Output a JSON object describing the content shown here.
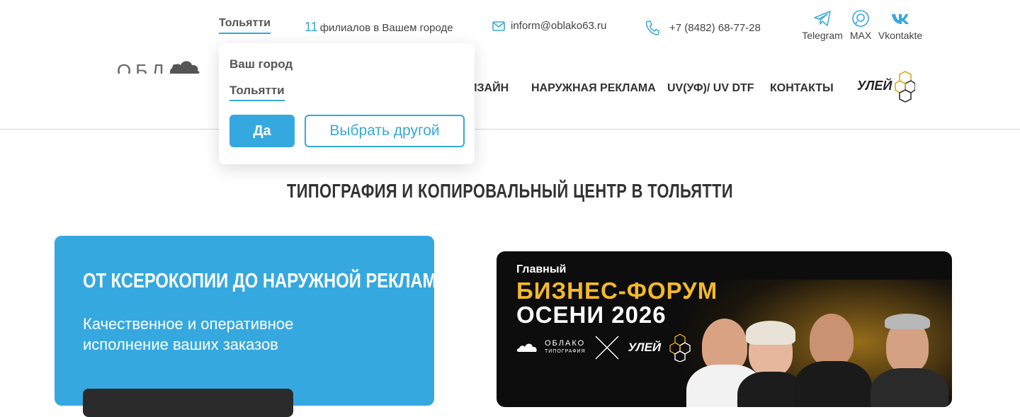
{
  "header": {
    "city": "Тольятти",
    "branches_count": "11",
    "branches_text": "филиалов в Вашем городе",
    "email": "inform@oblako63.ru",
    "phone": "+7 (8482) 68-77-28",
    "logo_text": "ОБЛА",
    "social": [
      {
        "label": "Telegram",
        "icon": "telegram-icon"
      },
      {
        "label": "MAX",
        "icon": "max-icon"
      },
      {
        "label": "Vkontakte",
        "icon": "vk-icon"
      }
    ],
    "nav": [
      {
        "label": "ИЗАЙН"
      },
      {
        "label": "НАРУЖНАЯ РЕКЛАМА"
      },
      {
        "label": "UV(УФ)/ UV DTF"
      },
      {
        "label": "КОНТАКТЫ"
      }
    ],
    "partner_logo": "УЛЕЙ"
  },
  "city_popup": {
    "title": "Ваш город",
    "city": "Тольятти",
    "yes_label": "Да",
    "other_label": "Выбрать другой"
  },
  "main": {
    "title": "ТИПОГРАФИЯ И КОПИРОВАЛЬНЫЙ ЦЕНТР В ТОЛЬЯТТИ",
    "promo": {
      "title": "ОТ КСЕРОКОПИИ ДО НАРУЖНОЙ РЕКЛАМЫ",
      "text": "Качественное и оперативное исполнение ваших заказов"
    },
    "banner": {
      "line1": "Главный",
      "line2": "БИЗНЕС-ФОРУМ",
      "line3": "ОСЕНИ 2026",
      "logo1": "ОБЛАКО",
      "logo1_sub": "ТИПОГРАФИЯ",
      "logo2": "УЛЕЙ"
    }
  },
  "colors": {
    "accent": "#36a8e0",
    "banner_bg": "#0d0d0d",
    "banner_gold": "#f4b92a"
  }
}
